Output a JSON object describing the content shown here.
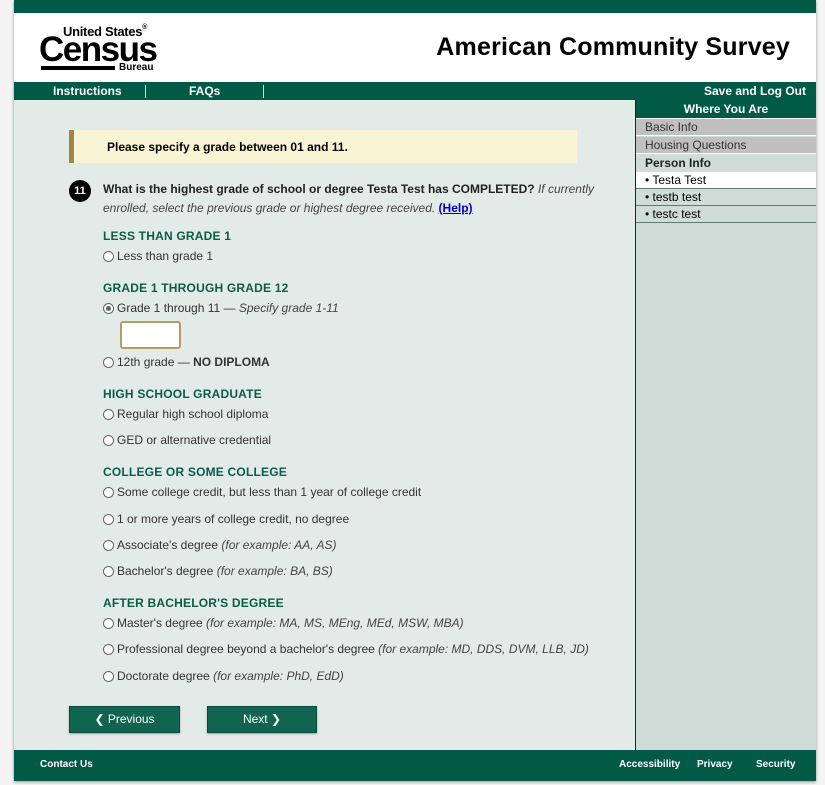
{
  "logo": {
    "line1": "United States",
    "reg": "®",
    "word": "Census",
    "line3": "Bureau"
  },
  "site_title": "American Community Survey",
  "nav": {
    "instructions": "Instructions",
    "faqs": "FAQs",
    "save_logout": "Save and Log Out"
  },
  "alert": {
    "message": "Please specify a grade between 01 and 11."
  },
  "question": {
    "number": "11",
    "text": "What is the highest grade of school or degree Testa Test has COMPLETED?",
    "instruction": "If currently enrolled, select the previous grade or highest degree received.",
    "help_label": "(Help)"
  },
  "sections": [
    {
      "heading": "Less than grade 1"
    },
    {
      "heading": "Grade 1 through grade 12"
    },
    {
      "heading": "High school graduate"
    },
    {
      "heading": "College or some college"
    },
    {
      "heading": "After bachelor's degree"
    }
  ],
  "options": [
    {
      "label": "Less than grade 1",
      "example": "",
      "checked": false
    },
    {
      "label": "Grade 1 through 11 —",
      "example": "Specify grade 1-11",
      "checked": true
    },
    {
      "label": "12th grade —",
      "bold": "NO DIPLOMA",
      "example": "",
      "checked": false
    },
    {
      "label": "Regular high school diploma",
      "example": "",
      "checked": false
    },
    {
      "label": "GED or alternative credential",
      "example": "",
      "checked": false
    },
    {
      "label": "Some college credit, but less than 1 year of college credit",
      "example": "",
      "checked": false
    },
    {
      "label": "1 or more years of college credit, no degree",
      "example": "",
      "checked": false
    },
    {
      "label": "Associate's degree",
      "example": "(for example: AA, AS)",
      "checked": false
    },
    {
      "label": "Bachelor's degree",
      "example": "(for example: BA, BS)",
      "checked": false
    },
    {
      "label": "Master's degree",
      "example": "(for example: MA, MS, MEng, MEd, MSW, MBA)",
      "checked": false
    },
    {
      "label": "Professional degree beyond a bachelor's degree",
      "example": "(for example: MD, DDS, DVM, LLB, JD)",
      "checked": false
    },
    {
      "label": "Doctorate degree",
      "example": "(for example: PhD, EdD)",
      "checked": false
    }
  ],
  "grade_input": {
    "value": ""
  },
  "buttons": {
    "previous": "Previous",
    "next": "Next"
  },
  "sidebar": {
    "title": "Where You Are",
    "basic_info": "Basic Info",
    "housing": "Housing Questions",
    "person_info": "Person Info",
    "persons": [
      "• Testa Test",
      "• testb test",
      "• testc test"
    ]
  },
  "footer": {
    "contact": "Contact Us",
    "accessibility": "Accessibility",
    "privacy": "Privacy",
    "security": "Security"
  },
  "colors": {
    "brand": "#005a46",
    "content_bg": "#e2ebe7",
    "sidebar_bg": "#cfdcd7",
    "alert_bg": "#f8f4d4",
    "alert_border": "#a3844a",
    "heading": "#0b5c48"
  }
}
